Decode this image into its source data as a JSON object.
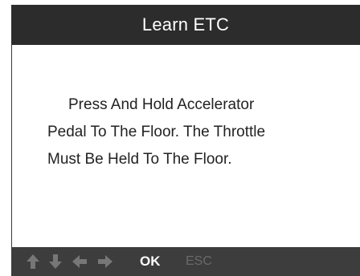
{
  "header": {
    "title": "Learn ETC"
  },
  "message": {
    "lines": [
      "Press And Hold Accelerator",
      "Pedal To The Floor. The Throttle",
      "Must Be Held To The Floor."
    ]
  },
  "footer": {
    "nav_icons": [
      "arrow-up-icon",
      "arrow-down-icon",
      "arrow-left-icon",
      "arrow-right-icon"
    ],
    "ok_label": "OK",
    "esc_label": "ESC"
  },
  "colors": {
    "header_bg": "#2c2c2c",
    "footer_bg": "#3d3d3d",
    "icon_inactive": "#777777",
    "ok_active": "#ffffff",
    "esc_inactive": "#6a6a6a"
  }
}
